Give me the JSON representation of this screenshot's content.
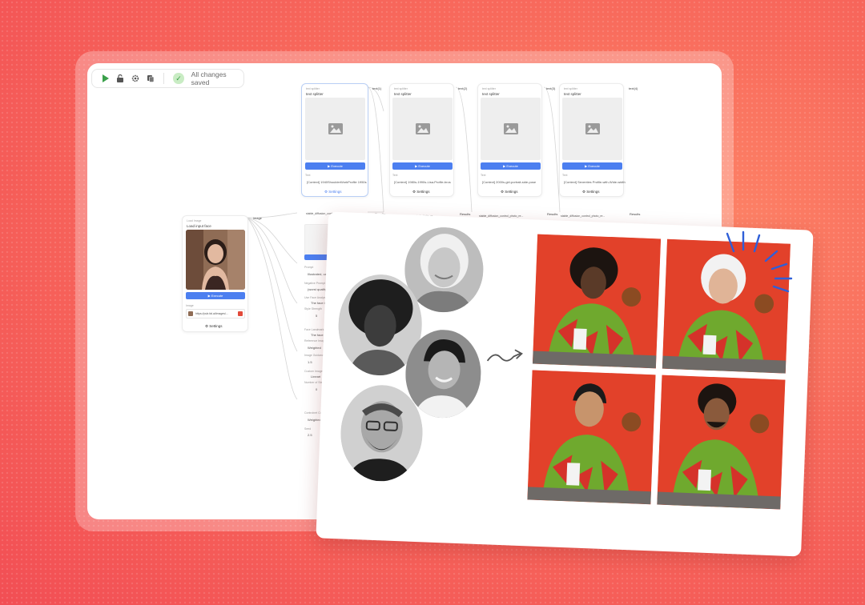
{
  "toolbar": {
    "status_text": "All changes saved",
    "icons": [
      "play-icon",
      "unlock-icon",
      "gear-icon",
      "copy-icon",
      "check-icon"
    ],
    "play_color": "#3aa04a"
  },
  "nodes": {
    "load_image": {
      "subtitle": "Load Image",
      "title": "Load input face",
      "execute_label": "Execute",
      "field_label": "Image",
      "url": "https://pub.fal.ai/images/...",
      "settings_label": "Settings",
      "out_port": "image"
    },
    "text_splitters": [
      {
        "subtitle": "text splitter",
        "title": "text splitter",
        "execute_label": "Execute",
        "text_label": "Text",
        "prompt": "[Context] 1940ShoulderWorkProfile 1950s",
        "settings_label": "Settings",
        "out_port": "text(1)"
      },
      {
        "subtitle": "text splitter",
        "title": "text splitter",
        "execute_label": "Execute",
        "text_label": "Text",
        "prompt": "[Context] 1980s-1990s-Lisa-Profile-bros",
        "settings_label": "Settings",
        "out_port": "text(2)"
      },
      {
        "subtitle": "text splitter",
        "title": "text splitter",
        "execute_label": "Execute",
        "text_label": "Text",
        "prompt": "[Context] 2000s-girl-portrait-side-pose",
        "settings_label": "Settings",
        "out_port": "text(3)"
      },
      {
        "subtitle": "text splitter",
        "title": "text splitter",
        "execute_label": "Execute",
        "text_label": "Text",
        "prompt": "[Context] Seventies Profile-with-Wide-width",
        "settings_label": "Settings",
        "out_port": "text(4)"
      }
    ],
    "diffusion": {
      "header": "stable_diffusion_control_photo_re...",
      "ports": [
        "Images",
        "Images",
        "Images",
        "Images"
      ],
      "out_ports": [
        "Results",
        "Results",
        "Results",
        "Results"
      ],
      "fields": [
        {
          "label": "Prompt",
          "value": "Illustrated, cartoon"
        },
        {
          "label": "Negative Prompt",
          "value": "(worst quality, lo"
        },
        {
          "label": "Use Face Analysis",
          "value": "The face is"
        },
        {
          "label": "Style Strength",
          "value": "5"
        },
        {
          "label": "Face Landmark Ratio",
          "value": "The face"
        },
        {
          "label": "Reference Image Count",
          "value": "Weighted"
        },
        {
          "label": "Image Guidance Scale",
          "value": "1.5"
        },
        {
          "label": "Custom Image",
          "value": "Lineart"
        },
        {
          "label": "Number of Steps",
          "value": "0"
        },
        {
          "label": "Controlnet Conditioning",
          "value": "Weighted"
        },
        {
          "label": "Seed",
          "value": "2.5"
        }
      ]
    }
  },
  "showcase": {
    "input_faces": [
      "elderly-woman-face",
      "young-man-afro-face",
      "smiling-asian-man-face",
      "bearded-man-glasses-face"
    ],
    "outputs": [
      "young-man-afro-result",
      "elderly-woman-result",
      "asian-man-result",
      "bearded-man-result"
    ],
    "colors": {
      "photo_bg": "#e2412a",
      "shirt_green": "#6fa92e",
      "shirt_red": "#d5322a",
      "table": "#6e6a67"
    }
  }
}
